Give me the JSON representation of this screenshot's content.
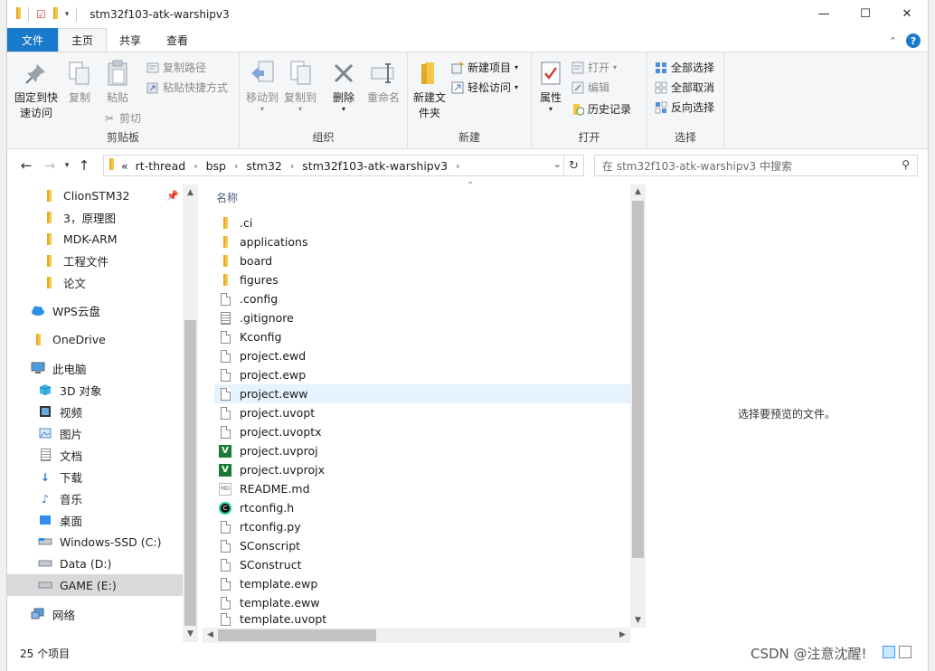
{
  "window": {
    "title": "stm32f103-atk-warshipv3",
    "controls": {
      "minimize": "—",
      "maximize": "☐",
      "close": "✕"
    }
  },
  "ribbon_tabs": {
    "file": "文件",
    "home": "主页",
    "share": "共享",
    "view": "查看"
  },
  "ribbon": {
    "clipboard": {
      "label": "剪贴板",
      "pin": "固定到快速访问",
      "copy": "复制",
      "paste": "粘贴",
      "copy_path": "复制路径",
      "paste_shortcut": "粘贴快捷方式",
      "cut": "剪切"
    },
    "organize": {
      "label": "组织",
      "move_to": "移动到",
      "copy_to": "复制到",
      "delete": "删除",
      "rename": "重命名"
    },
    "new": {
      "label": "新建",
      "new_folder": "新建文件夹",
      "new_item": "新建项目",
      "easy_access": "轻松访问"
    },
    "open": {
      "label": "打开",
      "properties": "属性",
      "open": "打开",
      "edit": "编辑",
      "history": "历史记录"
    },
    "select": {
      "label": "选择",
      "select_all": "全部选择",
      "select_none": "全部取消",
      "invert": "反向选择"
    }
  },
  "address": {
    "overflow": "«",
    "crumbs": [
      "rt-thread",
      "bsp",
      "stm32",
      "stm32f103-atk-warshipv3"
    ],
    "search_placeholder": "在 stm32f103-atk-warshipv3 中搜索"
  },
  "nav": {
    "items": [
      {
        "label": "ClionSTM32",
        "icon": "folder-icon",
        "pinned": true
      },
      {
        "label": "3，原理图",
        "icon": "folder-icon"
      },
      {
        "label": "MDK-ARM",
        "icon": "folder-icon"
      },
      {
        "label": "工程文件",
        "icon": "folder-icon"
      },
      {
        "label": "论文",
        "icon": "folder-icon"
      },
      {
        "label": "WPS云盘",
        "icon": "cloud-icon"
      },
      {
        "label": "OneDrive",
        "icon": "folder-icon"
      },
      {
        "label": "此电脑",
        "icon": "computer-icon"
      },
      {
        "label": "3D 对象",
        "icon": "cube-icon"
      },
      {
        "label": "视频",
        "icon": "video-icon"
      },
      {
        "label": "图片",
        "icon": "picture-icon"
      },
      {
        "label": "文档",
        "icon": "document-icon"
      },
      {
        "label": "下载",
        "icon": "download-icon"
      },
      {
        "label": "音乐",
        "icon": "music-icon"
      },
      {
        "label": "桌面",
        "icon": "desktop-icon"
      },
      {
        "label": "Windows-SSD (C:)",
        "icon": "drive-icon"
      },
      {
        "label": "Data (D:)",
        "icon": "drive-icon"
      },
      {
        "label": "GAME (E:)",
        "icon": "drive-icon"
      },
      {
        "label": "网络",
        "icon": "network-icon"
      }
    ]
  },
  "filelist": {
    "column_name": "名称",
    "files": [
      {
        "name": ".ci",
        "icon": "folder-icon"
      },
      {
        "name": "applications",
        "icon": "folder-icon"
      },
      {
        "name": "board",
        "icon": "folder-icon"
      },
      {
        "name": "figures",
        "icon": "folder-icon"
      },
      {
        "name": ".config",
        "icon": "file-icon"
      },
      {
        "name": ".gitignore",
        "icon": "text-file-icon"
      },
      {
        "name": "Kconfig",
        "icon": "file-icon"
      },
      {
        "name": "project.ewd",
        "icon": "file-icon"
      },
      {
        "name": "project.ewp",
        "icon": "file-icon"
      },
      {
        "name": "project.eww",
        "icon": "file-icon"
      },
      {
        "name": "project.uvopt",
        "icon": "file-icon"
      },
      {
        "name": "project.uvoptx",
        "icon": "file-icon"
      },
      {
        "name": "project.uvproj",
        "icon": "keil-project-icon"
      },
      {
        "name": "project.uvprojx",
        "icon": "keil-project-icon"
      },
      {
        "name": "README.md",
        "icon": "markdown-icon"
      },
      {
        "name": "rtconfig.h",
        "icon": "clion-icon"
      },
      {
        "name": "rtconfig.py",
        "icon": "file-icon"
      },
      {
        "name": "SConscript",
        "icon": "file-icon"
      },
      {
        "name": "SConstruct",
        "icon": "file-icon"
      },
      {
        "name": "template.ewp",
        "icon": "file-icon"
      },
      {
        "name": "template.eww",
        "icon": "file-icon"
      },
      {
        "name": "template.uvopt",
        "icon": "file-icon"
      }
    ]
  },
  "preview": {
    "message": "选择要预览的文件。"
  },
  "status": {
    "item_count": "25 个项目"
  },
  "watermark": "CSDN @注意沈醒!",
  "colors": {
    "accent": "#1979ca",
    "selection": "#cce8ff",
    "hover": "#e5f3ff",
    "folder": "#f6c745"
  }
}
